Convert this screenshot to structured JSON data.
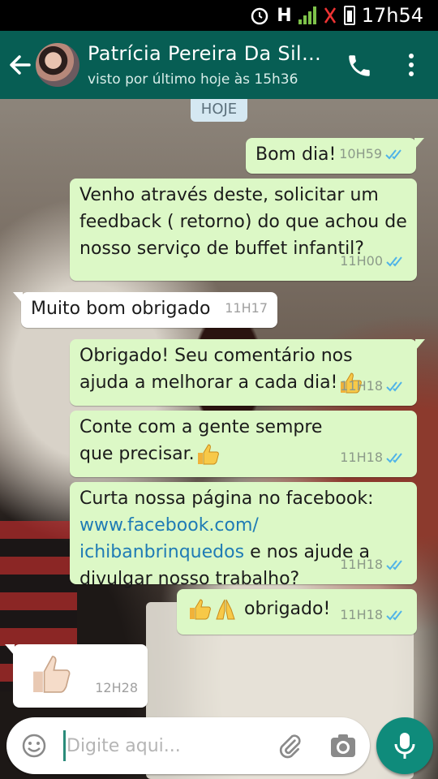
{
  "status_bar": {
    "network_label": "H",
    "time": "17h54"
  },
  "header": {
    "contact_name": "Patrícia Pereira Da Silv…",
    "last_seen": "visto por último hoje às 15h36"
  },
  "chat": {
    "date_chip": "HOJE",
    "messages": [
      {
        "direction": "out",
        "text": "Bom dia!",
        "time": "10H59",
        "ticks": "double-blue"
      },
      {
        "direction": "out",
        "text": "Venho através deste, solicitar um feedback ( retorno) do que achou de nosso serviço de buffet infantil?",
        "time": "11H00",
        "ticks": "double-blue"
      },
      {
        "direction": "in",
        "text": "Muito bom obrigado",
        "time": "11H17"
      },
      {
        "direction": "out",
        "text": "Obrigado! Seu comentário nos ajuda a melhorar a cada dia!",
        "emoji": "thumbs-up",
        "time": "11H18",
        "ticks": "double-blue"
      },
      {
        "direction": "out",
        "text": "Conte com a gente sempre que precisar.",
        "emoji": "thumbs-up",
        "time": "11H18",
        "ticks": "double-blue"
      },
      {
        "direction": "out",
        "text_before_link": "Curta nossa página no facebook:",
        "link": "www.facebook.com/ ichibanbrinquedos",
        "text_after_link": "e nos ajude a divulgar nosso trabalho?",
        "time": "11H18",
        "ticks": "double-blue"
      },
      {
        "direction": "out",
        "emoji": "thumbs-up folded-hands",
        "text": "obrigado!",
        "time": "11H18",
        "ticks": "double-blue"
      },
      {
        "direction": "in",
        "emoji": "thumbs-up",
        "time": "12H28"
      }
    ]
  },
  "composer": {
    "placeholder": "Digite aqui...",
    "icons": [
      "smiley-icon",
      "attach-icon",
      "camera-icon",
      "mic-icon"
    ]
  },
  "colors": {
    "header": "#075e54",
    "outgoing_bubble": "#dcf8c6",
    "incoming_bubble": "#ffffff",
    "link": "#1f7bb5",
    "read_ticks": "#4fb3e8",
    "mic_button": "#0f8b7b"
  }
}
